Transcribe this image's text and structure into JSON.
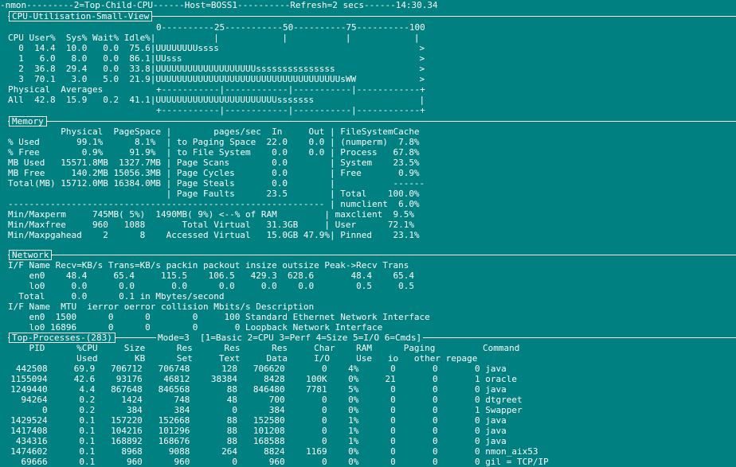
{
  "title_bar": "-nmon---------2=Top-Child-CPU------Host=BOSS1----------Refresh=2 secs------14:30.34",
  "cpu": {
    "title": "CPU-Utilisation-Small-View",
    "scale": "0----------25-----------50----------75----------100",
    "header": "CPU User%  Sys% Wait% Idle%|           |            |           |            |",
    "rows": [
      "  0  14.4  10.0   0.0  75.6|UUUUUUUUssss                                      >",
      "  1   6.0   8.0   0.0  86.1|UUsss                                             >",
      "  2  36.8  29.4   0.0  33.8|UUUUUUUUUUUUUUUUUUUsssssssssssssss                >",
      "  3  70.1   3.0   5.0  21.9|UUUUUUUUUUUUUUUUUUUUUUUUUUUUUUUUUUUsWW            >"
    ],
    "phys_label": "Physical  Averages",
    "phys_divider": "+-----------|------------|-----------|------------+",
    "all_row": "All  42.8  15.9   0.2  41.1|UUUUUUUUUUUUUUUUUUUUUUUsssssss                    |",
    "bottom_divider": "+-----------|------------|-----------|------------+"
  },
  "memory": {
    "title": "Memory",
    "lines": [
      "          Physical  PageSpace |        pages/sec  In     Out | FileSystemCache",
      "% Used       99.1%      8.1%  | to Paging Space  22.0    0.0 | (numperm)  7.8%",
      "% Free        0.9%     91.9%  | to File System    0.0    0.0 | Process   67.8%",
      "MB Used   15571.8MB  1327.7MB | Page Scans        0.0        | System    23.5%",
      "MB Free     140.2MB 15056.3MB | Page Cycles       0.0        | Free       0.9%",
      "Total(MB) 15712.0MB 16384.0MB | Page Steals       0.0        |           ------",
      "                              | Page Faults      23.5        | Total    100.0%",
      "------------------------------------------------------------ | numclient  6.0%",
      "Min/Maxperm     745MB( 5%)  1490MB( 9%) <--% of RAM         | maxclient  9.5%",
      "Min/Maxfree     960   1088       Total Virtual   31.3GB     | User      72.1%",
      "Min/Maxpgahead    2      8    Accessed Virtual   15.0GB 47.9%| Pinned    23.1%"
    ]
  },
  "network": {
    "title": "Network",
    "lines": [
      "I/F Name Recv=KB/s Trans=KB/s packin packout insize outsize Peak->Recv Trans",
      "    en0    48.4     65.4     115.5    106.5   429.3  628.6       48.4    65.4",
      "    lo0     0.0      0.0       0.0      0.0     0.0    0.0        0.5     0.5",
      "  Total     0.0      0.1 in Mbytes/second",
      "I/F Name  MTU  ierror oerror collision Mbits/s Description",
      "    en0  1500      0      0        0     100 Standard Ethernet Network Interface",
      "    lo0 16896      0      0        0       0 Loopback Network Interface"
    ]
  },
  "top": {
    "title": "Top-Processes-(283)",
    "mode_text": "Mode=3  [1=Basic 2=CPU 3=Perf 4=Size 5=I/O 6=Cmds]",
    "header1": "    PID      %CPU     Size      Res      Res      Res     Char    RAM      Paging         Command",
    "header2": "             Used       KB      Set     Text     Data     I/O     Use   io   other repage",
    "rows": [
      "   442508     69.9   706712   706748      128   706620       0    4%      0       0       0 java",
      "  1155094     42.6    93176    46812    38384     8428    100K    0%     21       0       1 oracle",
      "  1249440      4.4   867648   846568       88   846480    7781    5%      0       0       0 java",
      "    94264      0.2     1424      748       48      700       0    0%      0       0       0 dtgreet",
      "        0      0.2      384      384        0      384       0    0%      0       0       1 Swapper",
      "  1429524      0.1   157220   152668       88   152580       0    1%      0       0       0 java",
      "  1417408      0.1   104216   101296       88   101208       0    1%      0       0       0 java",
      "   434316      0.1   168892   168676       88   168588       0    1%      0       0       0 java",
      "  1474602      0.1     8968     9088      264     8824    1169    0%      0       0       0 nmon_aix53",
      "    69666      0.1      960      960        0      960       0    0%      0       0       0 gil = TCP/IP"
    ]
  }
}
